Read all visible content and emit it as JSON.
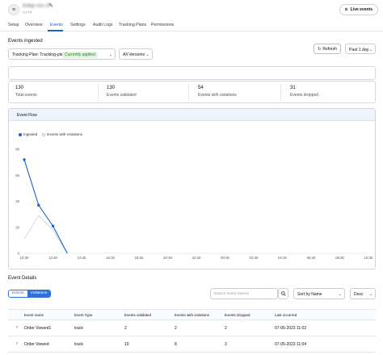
{
  "header": {
    "source_name": "tmkp-src-3",
    "source_type": "HTTP",
    "live_events_label": "Live events"
  },
  "tabs": [
    {
      "label": "Setup",
      "active": false
    },
    {
      "label": "Overview",
      "active": false
    },
    {
      "label": "Events",
      "active": true
    },
    {
      "label": "Settings",
      "active": false
    },
    {
      "label": "Audit Logs",
      "active": false
    },
    {
      "label": "Tracking Plans",
      "active": false
    },
    {
      "label": "Permissions",
      "active": false
    }
  ],
  "events_ingested": {
    "title": "Events ingested",
    "tracking_plan_label": "Tracking Plan: Tracking-plan-64",
    "tracking_plan_badge": "Currently applied",
    "version_label": "All Versions",
    "refresh_label": "Refresh",
    "period_label": "Past 1 day"
  },
  "stats": [
    {
      "value": "130",
      "label": "Total events"
    },
    {
      "value": "130",
      "label": "Events validated"
    },
    {
      "value": "54",
      "label": "Events with violations"
    },
    {
      "value": "31",
      "label": "Events dropped"
    }
  ],
  "colors": {
    "accent": "#1a5fd6",
    "ingested_series": "#1f5fc8",
    "violations_series": "#c5d3ea",
    "badge_bg": "#e2f4e0",
    "badge_text": "#2e7d32"
  },
  "chart_data": {
    "type": "line",
    "title": "Event Flow",
    "x": [
      "10:30",
      "12:30",
      "14:30",
      "16:30",
      "18:30",
      "20:30",
      "22:30",
      "00:30",
      "02:30",
      "04:30",
      "06:30",
      "08:30",
      "10:30"
    ],
    "yticks": [
      0,
      20,
      40,
      60,
      80
    ],
    "ylim": [
      0,
      80
    ],
    "xlim": [
      0,
      24
    ],
    "grid": false,
    "legend": "top-left",
    "series": [
      {
        "name": "Ingested",
        "points": [
          [
            0,
            72
          ],
          [
            1,
            37
          ],
          [
            2,
            21
          ],
          [
            3,
            0
          ]
        ]
      },
      {
        "name": "Events with Violations",
        "points": [
          [
            0,
            11
          ],
          [
            1,
            29
          ],
          [
            2,
            18
          ],
          [
            3,
            0
          ]
        ]
      }
    ]
  },
  "event_details": {
    "title": "Event Details",
    "toggle": [
      "Events",
      "Violations"
    ],
    "active_toggle": "Violations",
    "search_placeholder": "Search event names",
    "sort_label": "Sort by Name",
    "order_label": "Desc",
    "columns": [
      "Event name",
      "Event Type",
      "Events validated",
      "Events with violations",
      "Events dropped",
      "Last occurred"
    ],
    "rows": [
      [
        "Order Viewed1",
        "track",
        "2",
        "2",
        "2",
        "07-05-2023 11:02"
      ],
      [
        "Order Viewed",
        "track",
        "10",
        "8",
        "3",
        "07-05-2023 11:04"
      ]
    ]
  }
}
